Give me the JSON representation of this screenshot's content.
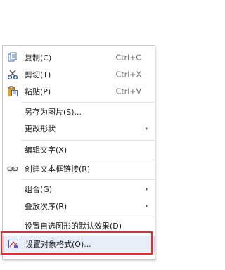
{
  "menu": {
    "items": [
      {
        "label": "复制(C)",
        "shortcut": "Ctrl+C",
        "icon": "copy-icon"
      },
      {
        "label": "剪切(T)",
        "shortcut": "Ctrl+X",
        "icon": "scissors-icon"
      },
      {
        "label": "粘贴(P)",
        "shortcut": "Ctrl+V",
        "icon": "paste-icon"
      },
      {
        "label": "另存为图片(S)..."
      },
      {
        "label": "更改形状"
      },
      {
        "label": "编辑文字(X)"
      },
      {
        "label": "创建文本框链接(R)",
        "icon": "link-icon"
      },
      {
        "label": "组合(G)"
      },
      {
        "label": "叠放次序(R)"
      },
      {
        "label": "设置自选图形的默认效果(D)"
      },
      {
        "label": "设置对象格式(O)...",
        "icon": "format-object-icon"
      }
    ]
  },
  "colors": {
    "highlight_border": "#f02828",
    "hover_background": "#e8eef8"
  }
}
